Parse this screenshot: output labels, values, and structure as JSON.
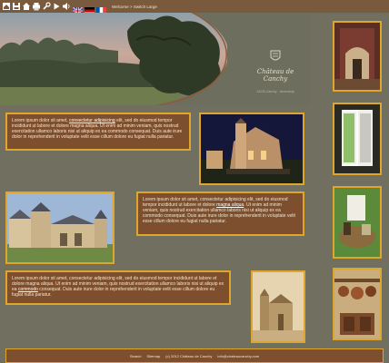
{
  "toolbar": {
    "icons": [
      "home-icon",
      "save-icon",
      "house-icon",
      "print-icon",
      "wrench-icon",
      "play-icon",
      "speaker-icon"
    ],
    "flags": [
      "uk-flag",
      "germany-flag",
      "france-flag"
    ],
    "breadcrumb": {
      "current": "Welcome",
      "separator": ">",
      "link": "Switch Large"
    }
  },
  "header": {
    "brand_title": "Château de Canchy",
    "brand_subtitle": "14230 Canchy - Normandy"
  },
  "blocks": [
    {
      "before": "Lorem ipsum dolor sit amet, ",
      "link": "consectetur adipisicing",
      "after": " elit, sed do eiusmod tempor incididunt ut labore et dolore magna aliqua. Ut enim ad minim veniam, quis nostrud exercitation ullamco laboris nisi ut aliquip ex ea commodo consequat. Duis aute irure dolor in reprehenderit in voluptate velit esse cillum dolore eu fugiat nulla pariatur."
    },
    {
      "before": "Lorem ipsum dolor sit amet, consectetur adipisicing elit, sed do eiusmod tempor incididunt ut labore et dolore ",
      "link": "magna aliqua",
      "after": ". Ut enim ad minim veniam, quis nostrud exercitation ullamco laboris nisi ut aliquip ex ea commodo consequat. Duis aute irure dolor in reprehenderit in voluptate velit esse cillum dolore eu fugiat nulla pariatur."
    },
    {
      "before": "Lorem ipsum dolor sit amet, consectetur adipisicing elit, sed do eiusmod tempor incididunt ut labore et dolore magna aliqua. Ut enim ad minim veniam, quis nostrud exercitation ullamco laboris nisi ut aliquip ex ea ",
      "link": "commodo",
      "after": " consequat. Duis aute irure dolor in reprehenderit in voluptate velit esse cillum dolore eu fugiat nulla pariatur."
    }
  ],
  "footer": {
    "search": "Search",
    "sitemap": "Sitemap",
    "copyright": "(c) 2012 Château de Canchy",
    "email": "info@chateaucanchy.com"
  },
  "colors": {
    "background": "#717060",
    "panel": "#7d4f2e",
    "frame": "#e0a52b",
    "toolbar": "#7a5a3c"
  }
}
